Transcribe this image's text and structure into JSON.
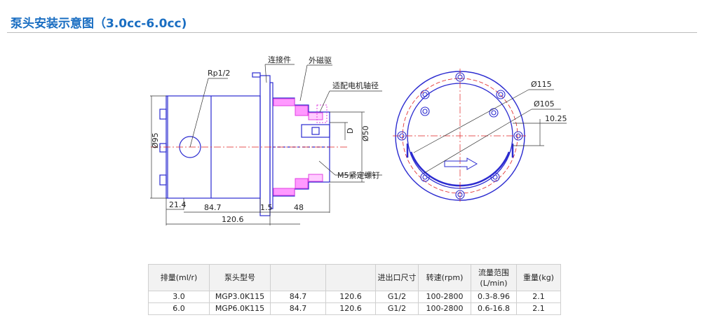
{
  "page": {
    "title": "泵头安装示意图（3.0cc-6.0cc)"
  },
  "drawing": {
    "labels": {
      "rp": "Rp1/2",
      "connector": "连接件",
      "outer_magnet": "外磁驱",
      "motor_shaft": "适配电机轴径",
      "d": "D",
      "d50": "Ø50",
      "d95": "Ø95",
      "m5": "M5紧定螺钉",
      "d115": "Ø115",
      "d105": "Ø105",
      "offset": "10.25"
    },
    "dimensions": {
      "d1": "21.4",
      "d2": "84.7",
      "d3": "1.5",
      "d4": "48",
      "total": "120.6"
    },
    "colors": {
      "outline": "#2b2bd0",
      "magnet": "#e040e0",
      "center": "#e02020",
      "dim": "#333333"
    }
  },
  "table": {
    "headers": [
      "排量(ml/r)",
      "泵头型号",
      "",
      "",
      "进出口尺寸",
      "转速(rpm)",
      "流量范围\n(L/min)",
      "重量(kg)"
    ],
    "rows": [
      [
        "3.0",
        "MGP3.0K115",
        "84.7",
        "120.6",
        "G1/2",
        "100-2800",
        "0.3-8.96",
        "2.1"
      ],
      [
        "6.0",
        "MGP6.0K115",
        "84.7",
        "120.6",
        "G1/2",
        "100-2800",
        "0.6-16.8",
        "2.1"
      ]
    ]
  }
}
